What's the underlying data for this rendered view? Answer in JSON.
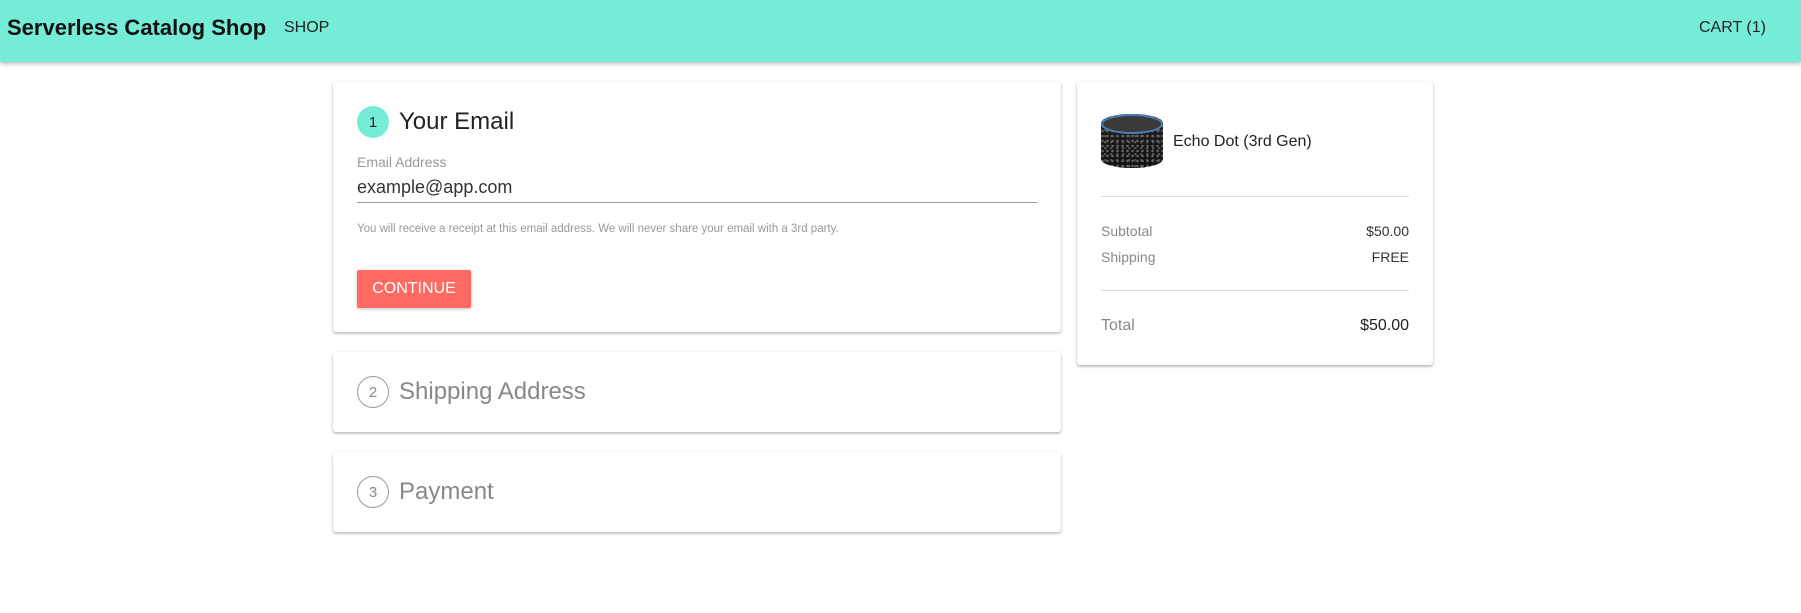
{
  "navbar": {
    "brand": "Serverless Catalog Shop",
    "shop_label": "SHOP",
    "cart_label": "CART (1)",
    "bg_color": "#75ecd6"
  },
  "checkout": {
    "email_step": {
      "number": "1",
      "title": "Your Email",
      "field_label": "Email Address",
      "email_value": "example@app.com",
      "help_text": "You will receive a receipt at this email address. We will never share your email with a 3rd party.",
      "continue_label": "CONTINUE"
    },
    "shipping_step": {
      "number": "2",
      "title": "Shipping Address"
    },
    "payment_step": {
      "number": "3",
      "title": "Payment"
    }
  },
  "summary": {
    "product": {
      "name": "Echo Dot (3rd Gen)",
      "image_icon": "echo-dot-product-image"
    },
    "subtotal_label": "Subtotal",
    "subtotal_value": "$50.00",
    "shipping_label": "Shipping",
    "shipping_value": "FREE",
    "total_label": "Total",
    "total_value": "$50.00"
  },
  "colors": {
    "accent": "#75ecd6",
    "button": "#ff6b63"
  }
}
